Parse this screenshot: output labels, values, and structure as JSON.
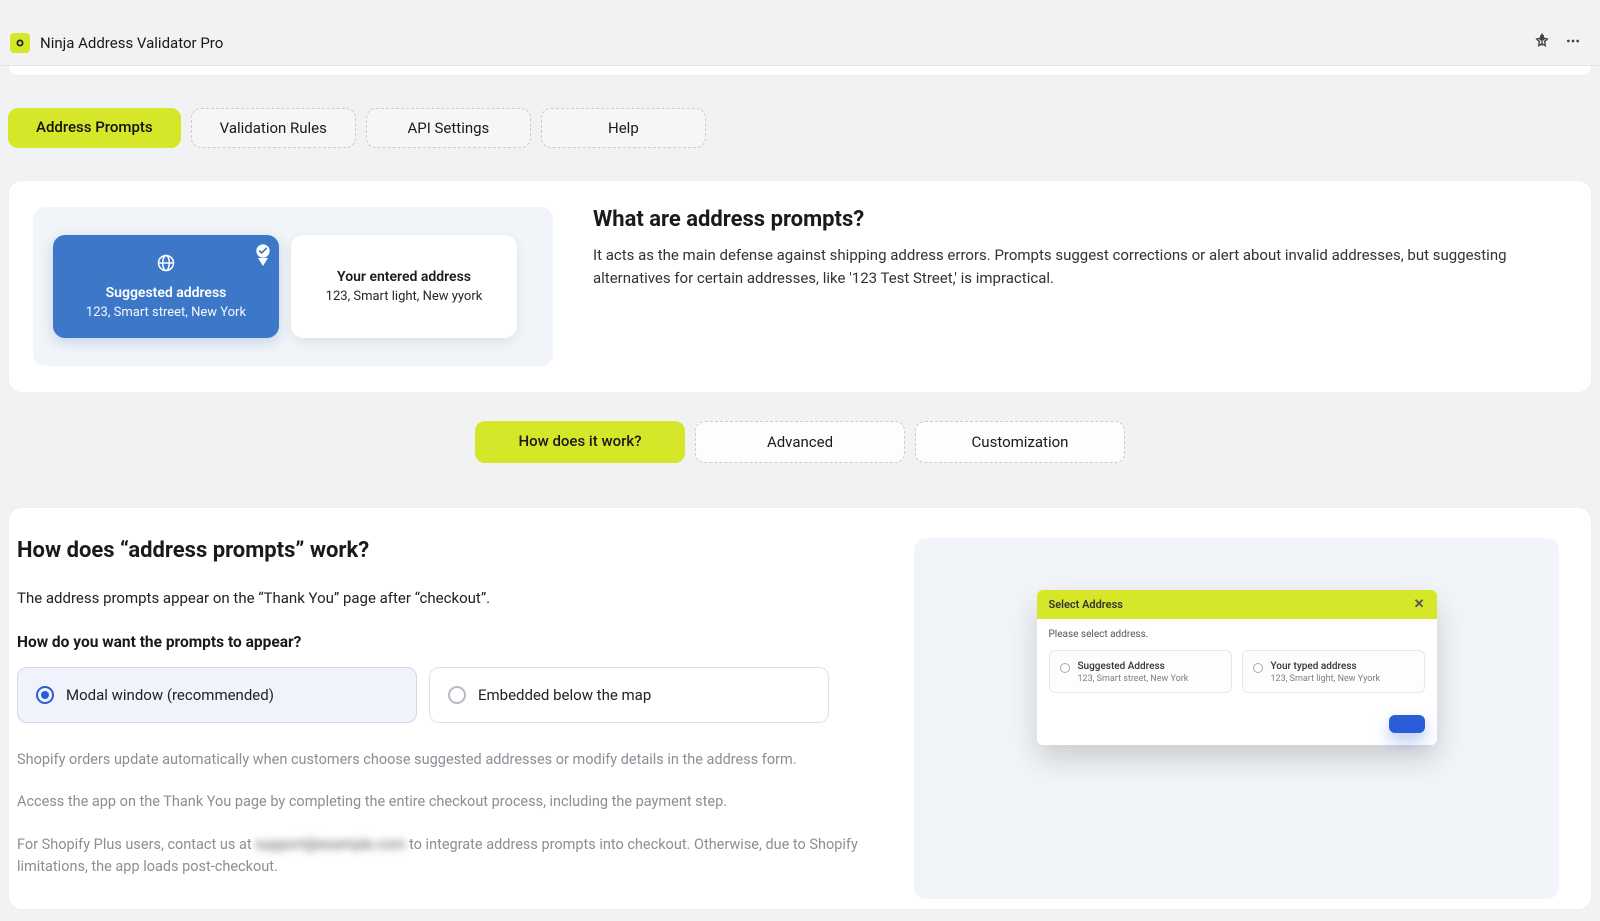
{
  "header": {
    "title": "Ninja Address Validator Pro"
  },
  "tabs": {
    "primary": [
      {
        "label": "Address Prompts",
        "active": true
      },
      {
        "label": "Validation Rules",
        "active": false
      },
      {
        "label": "API Settings",
        "active": false
      },
      {
        "label": "Help",
        "active": false
      }
    ],
    "secondary": [
      {
        "label": "How does it work?",
        "active": true
      },
      {
        "label": "Advanced",
        "active": false
      },
      {
        "label": "Customization",
        "active": false
      }
    ]
  },
  "intro": {
    "suggested_card": {
      "title": "Suggested address",
      "value": "123, Smart street, New York"
    },
    "entered_card": {
      "title": "Your entered address",
      "value": "123, Smart light, New yyork"
    },
    "heading": "What are address prompts?",
    "body": "It acts as the main defense against shipping address errors. Prompts suggest corrections or alert about invalid addresses, but suggesting alternatives for certain addresses, like '123 Test Street,' is impractical."
  },
  "how": {
    "heading": "How does “address prompts” work?",
    "desc": "The address prompts appear on the “Thank You” page after “checkout”.",
    "question": "How do you want the prompts to appear?",
    "options": [
      {
        "label": "Modal window (recommended)",
        "selected": true
      },
      {
        "label": "Embedded below the map",
        "selected": false
      }
    ],
    "notes": {
      "n1": "Shopify orders update automatically when customers choose suggested addresses or modify details in the address form.",
      "n2": "Access the app on the Thank You page by completing the entire checkout process, including the payment step.",
      "n3a": "For Shopify Plus users, contact us at ",
      "n3b": " to integrate address prompts into checkout. Otherwise, due to Shopify limitations, the app loads post-checkout.",
      "blur": "support@example.com"
    }
  },
  "modal_preview": {
    "title": "Select Address",
    "prompt": "Please select address.",
    "opt1_title": "Suggested Address",
    "opt1_sub": "123, Smart street, New York",
    "opt2_title": "Your typed address",
    "opt2_sub": "123, Smart light, New Yyork"
  }
}
